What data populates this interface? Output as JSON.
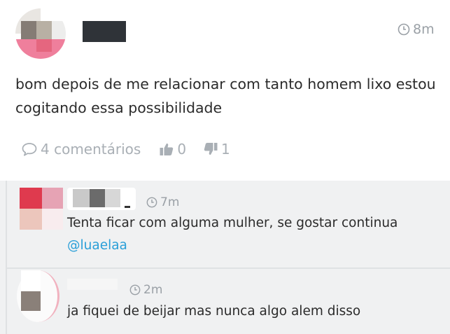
{
  "post": {
    "timestamp": "8m",
    "text_line1": "bom depois de me relacionar com tanto homem lixo estou",
    "text_line2": "cogitando essa possibilidade",
    "comments_label": "4 comentários",
    "likes": "0",
    "dislikes": "1"
  },
  "comments": [
    {
      "timestamp": "7m",
      "text": "Tenta ficar com alguma mulher, se gostar continua",
      "mention": "@luaelaa"
    },
    {
      "timestamp": "2m",
      "text": "ja fiquei de beijar mas nunca algo alem disso"
    }
  ],
  "colors": {
    "mention": "#2a9fd8",
    "muted": "#a9afb5",
    "thread_bg": "#f0f1f2"
  },
  "icons": {
    "clock": "clock-icon",
    "comment": "comment-bubble-icon",
    "like": "thumbs-up-icon",
    "dislike": "thumbs-down-icon"
  }
}
